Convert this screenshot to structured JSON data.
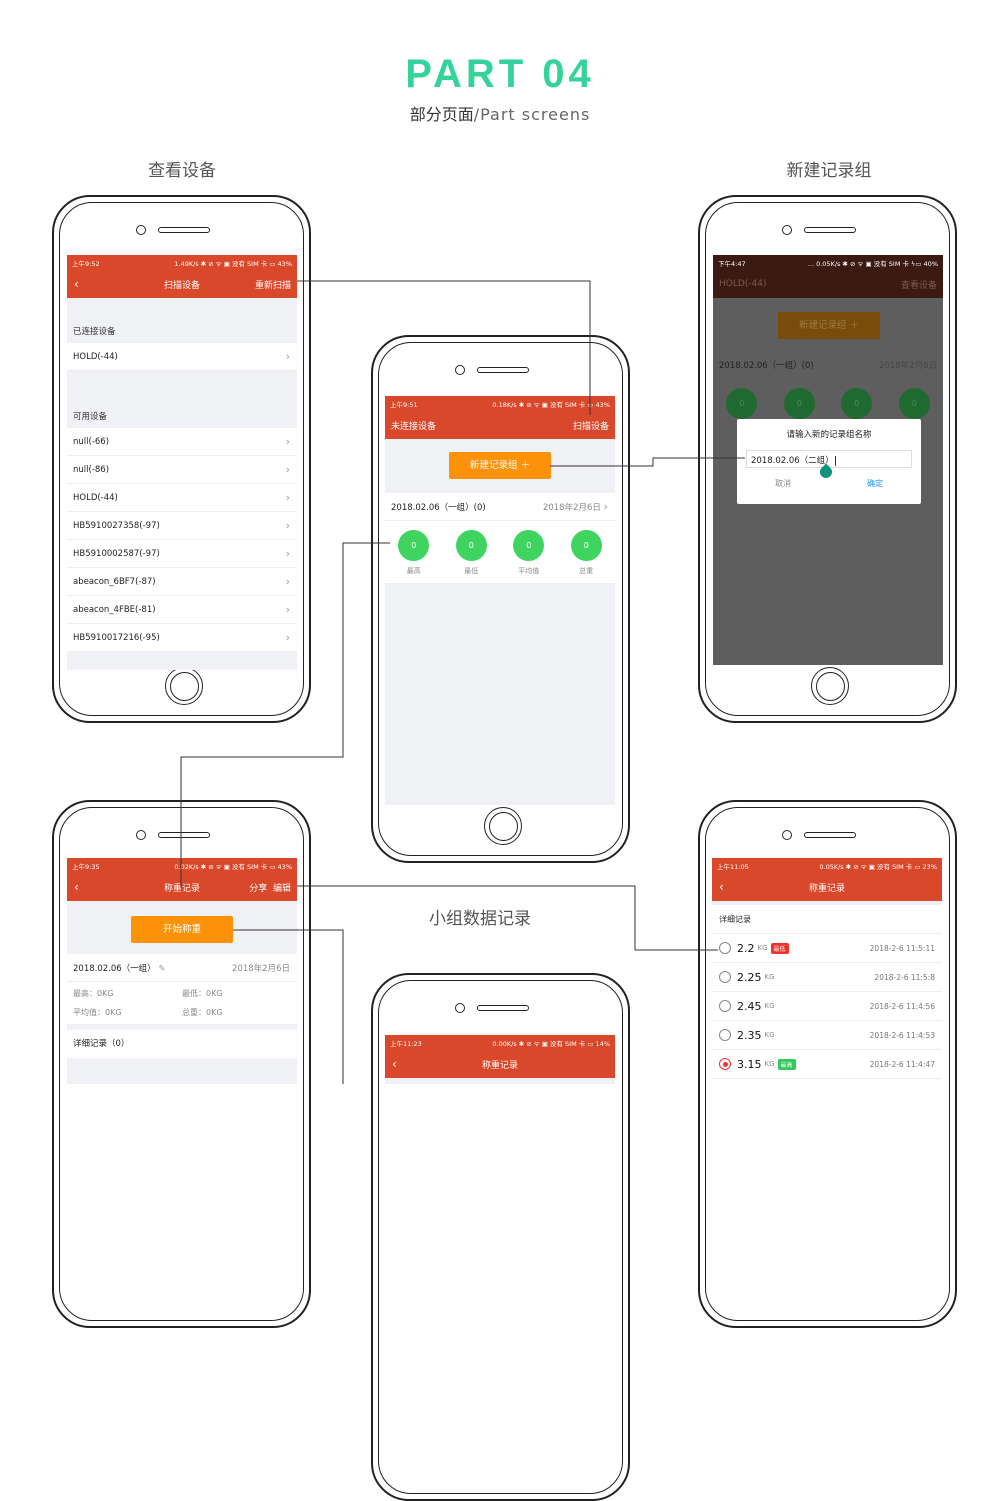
{
  "header": {
    "title": "PART 04",
    "subtitle_cn": "部分页面",
    "subtitle_en": "/Part screens"
  },
  "captions": {
    "view_devices": "查看设备",
    "new_group": "新建记录组",
    "group_records": "小组数据记录"
  },
  "colors": {
    "accent": "#d9482b",
    "orange": "#fb9209",
    "green": "#3ed45f",
    "title": "#34d399"
  },
  "scan": {
    "status": {
      "time": "上午9:52",
      "right": "1.49K/s ✱ ⊘ ᯤ ▣ 没有 SIM 卡 ▭ 43%"
    },
    "nav": {
      "back": "‹",
      "title": "扫描设备",
      "action": "重新扫描"
    },
    "connected_label": "已连接设备",
    "connected": [
      "HOLD(-44)"
    ],
    "available_label": "可用设备",
    "available": [
      "null(-66)",
      "null(-86)",
      "HOLD(-44)",
      "HB5910027358(-97)",
      "HB5910002587(-97)",
      "abeacon_6BF7(-87)",
      "abeacon_4FBE(-81)",
      "HB5910017216(-95)"
    ]
  },
  "home": {
    "status": {
      "time": "上午9:51",
      "right": "0.18K/s ✱ ⊘ ᯤ ▣ 没有 SIM 卡 ▭ 43%"
    },
    "nav": {
      "left": "未连接设备",
      "action": "扫描设备"
    },
    "new_button": "新建记录组 ＋",
    "group": {
      "name": "2018.02.06（一组）(0)",
      "date": "2018年2月6日"
    },
    "stats": [
      {
        "value": "0",
        "label": "最高"
      },
      {
        "value": "0",
        "label": "最低"
      },
      {
        "value": "0",
        "label": "平均值"
      },
      {
        "value": "0",
        "label": "总重"
      }
    ]
  },
  "dialog_screen": {
    "status": {
      "time": "下午4:47",
      "right": "... 0.05K/s ✱ ⊘ ᯤ ▣ 没有 SIM 卡 ϟ▭ 40%"
    },
    "nav": {
      "left": "HOLD(-44)",
      "action": "查看设备"
    },
    "new_button": "新建记录组 ＋",
    "group": {
      "name": "2018.02.06（一组）(0)",
      "date": "2018年2月6日"
    },
    "dialog": {
      "title": "请输入新的记录组名称",
      "input_value": "2018.02.06（二组）",
      "cancel": "取消",
      "confirm": "确定"
    }
  },
  "record": {
    "status": {
      "time": "上午9:35",
      "right": "0.02K/s ✱ ⊘ ᯤ ▣ 没有 SIM 卡 ▭ 43%"
    },
    "nav": {
      "back": "‹",
      "title": "称重记录",
      "share": "分享",
      "edit": "编辑"
    },
    "start_button": "开始称重",
    "group_name": "2018.02.06（一组）",
    "date": "2018年2月6日",
    "max": "最高：0KG",
    "min": "最低：0KG",
    "avg": "平均值：0KG",
    "total": "总重：0KG",
    "detail": "详细记录（0）"
  },
  "record2": {
    "status": {
      "time": "上午11:23",
      "right": "0.00K/s ✱ ⊘ ᯤ ▣ 没有 SIM 卡 ▭ 14%"
    },
    "nav": {
      "back": "‹",
      "title": "称重记录"
    }
  },
  "detail": {
    "status": {
      "time": "上午11:05",
      "right": "0.05K/s ✱ ⊘ ᯤ ▣ 没有 SIM 卡 ▭ 23%"
    },
    "nav": {
      "back": "‹",
      "title": "称重记录"
    },
    "section": "详细记录",
    "records": [
      {
        "value": "2.2",
        "unit": "KG",
        "badge": "最低",
        "badge_color": "#f0302a",
        "time": "2018-2-6 11:5:11",
        "selected": false
      },
      {
        "value": "2.25",
        "unit": "KG",
        "badge": "",
        "time": "2018-2-6 11:5:8",
        "selected": false
      },
      {
        "value": "2.45",
        "unit": "KG",
        "badge": "",
        "time": "2018-2-6 11:4:56",
        "selected": false
      },
      {
        "value": "2.35",
        "unit": "KG",
        "badge": "",
        "time": "2018-2-6 11:4:53",
        "selected": false
      },
      {
        "value": "3.15",
        "unit": "KG",
        "badge": "最高",
        "badge_color": "#34c759",
        "time": "2018-2-6 11:4:47",
        "selected": true
      }
    ]
  }
}
